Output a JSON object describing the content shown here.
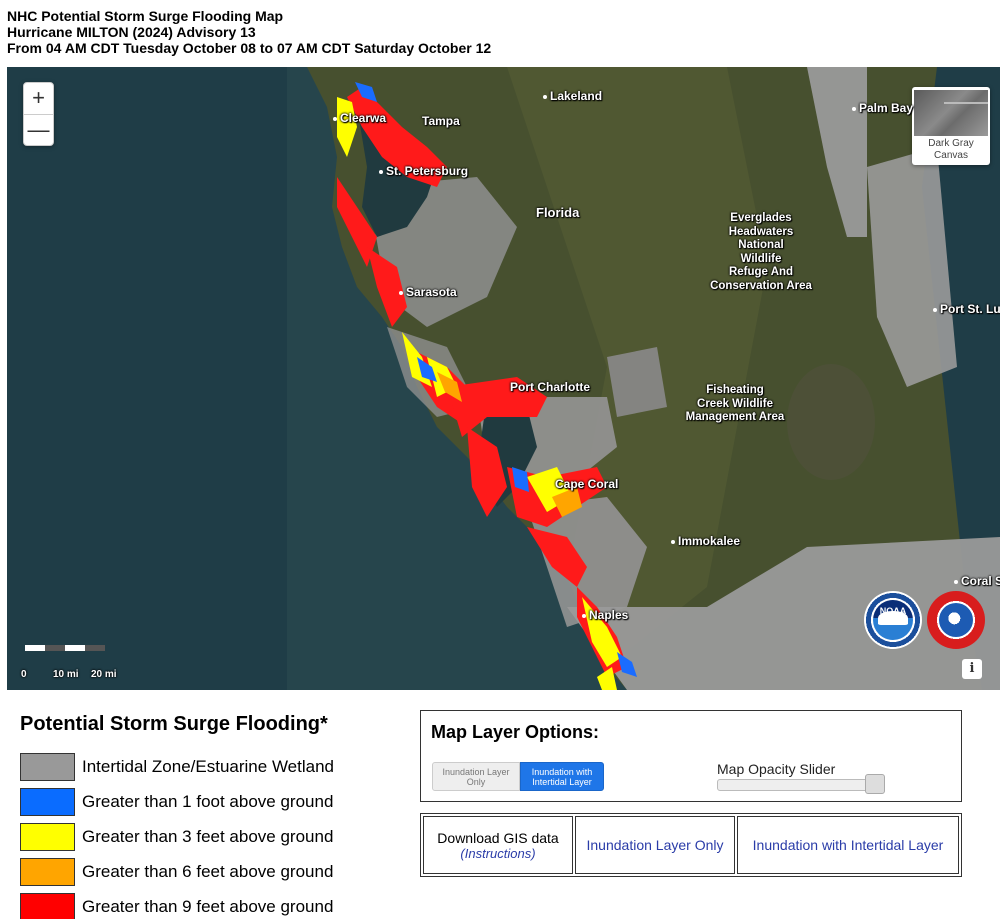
{
  "header": {
    "line1": "NHC Potential Storm Surge Flooding Map",
    "line2": "Hurricane MILTON (2024) Advisory 13",
    "line3": "From 04 AM CDT Tuesday October 08 to 07 AM CDT Saturday October 12"
  },
  "map": {
    "zoom_in": "+",
    "zoom_out": "—",
    "basemap_caption_1": "Dark Gray",
    "basemap_caption_2": "Canvas",
    "places": {
      "lakeland": "Lakeland",
      "clearwater": "Clearwa",
      "tampa": "Tampa",
      "st_petersburg": "St. Petersburg",
      "florida": "Florida",
      "palm_bay": "Palm Bay",
      "sarasota": "Sarasota",
      "port_st_lucie": "Port St. Luc",
      "port_charlotte": "Port Charlotte",
      "cape_coral": "Cape Coral",
      "immokalee": "Immokalee",
      "naples": "Naples",
      "coral_springs": "Coral S",
      "everglades_headwaters": "Everglades\nHeadwaters\nNational\nWildlife\nRefuge And\nConservation Area",
      "fisheating_creek": "Fisheating\nCreek Wildlife\nManagement Area"
    },
    "scale": {
      "zero": "0",
      "ten": "10 mi",
      "twenty": "20 mi"
    },
    "logos": {
      "noaa": "NOAA"
    },
    "info_label": "i"
  },
  "legend": {
    "title": "Potential Storm Surge Flooding*",
    "items": [
      {
        "label": "Intertidal Zone/Estuarine Wetland",
        "color": "#999999"
      },
      {
        "label": "Greater than 1 foot above ground",
        "color": "#0a6cff"
      },
      {
        "label": "Greater than 3 feet above ground",
        "color": "#ffff00"
      },
      {
        "label": "Greater than 6 feet above ground",
        "color": "#ffa500"
      },
      {
        "label": "Greater than 9 feet above ground",
        "color": "#ff0000"
      }
    ]
  },
  "layer_options": {
    "title": "Map Layer Options:",
    "toggle_off_label": "Inundation Layer Only",
    "toggle_on_label": "Inundation with Intertidal Layer",
    "slider_label": "Map Opacity Slider",
    "slider_value": 1.0
  },
  "downloads": {
    "gis_label": "Download GIS data",
    "gis_instructions": "(Instructions)",
    "inundation_only": "Inundation Layer Only",
    "inundation_intertidal": "Inundation with Intertidal Layer"
  }
}
